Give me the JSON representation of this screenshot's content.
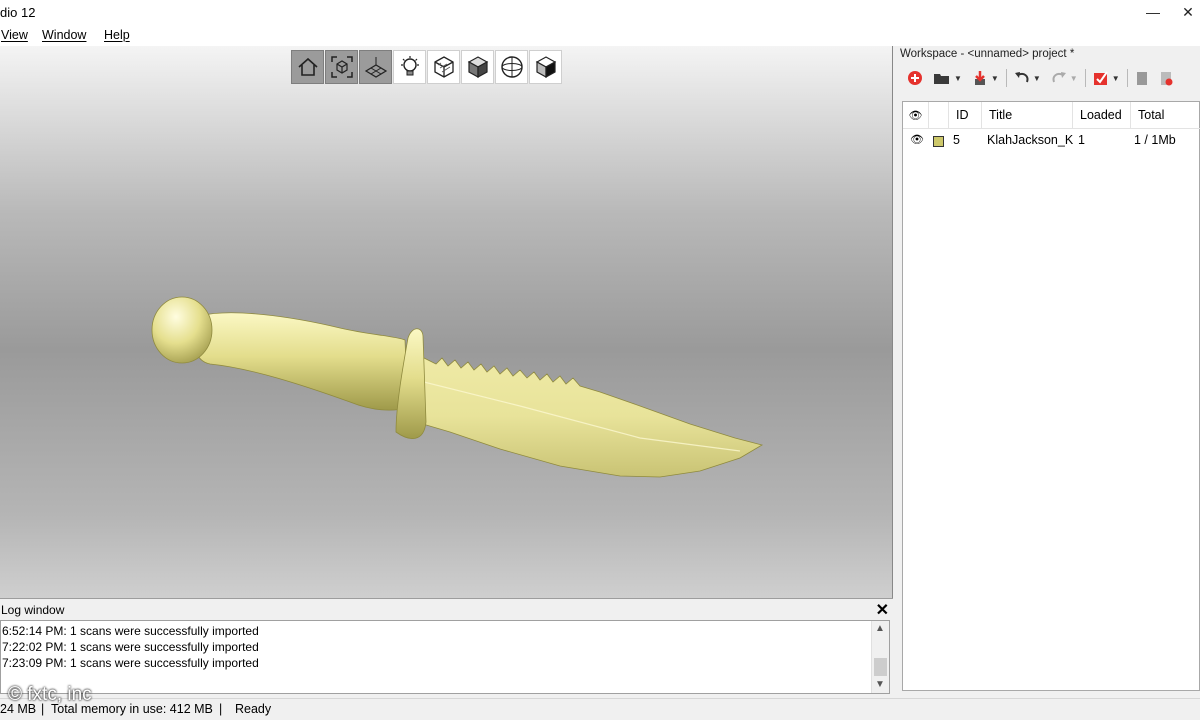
{
  "titlebar": {
    "title": "dio 12",
    "minimize": "—",
    "close": "✕"
  },
  "menu": {
    "view": "View",
    "window": "Window",
    "help": "Help"
  },
  "viewport": {
    "tools": [
      "home-view-icon",
      "fit-view-icon",
      "grid-view-icon",
      "light-bulb-icon",
      "wireframe-cube-icon",
      "shaded-cube-icon",
      "sphere-icon",
      "textured-cube-icon"
    ],
    "object_color": "#e8e39a"
  },
  "log": {
    "title": "Log window",
    "close": "✕",
    "lines": [
      "6:52:14 PM: 1 scans were successfully imported",
      "7:22:02 PM: 1 scans were successfully imported",
      "7:23:09 PM: 1 scans were successfully imported"
    ],
    "scroll_up": "▲",
    "scroll_down": "▼"
  },
  "status": {
    "mem_current": "24 MB",
    "sep1": "|",
    "total_memory": "Total memory in use: 412 MB",
    "sep2": "|",
    "state": "Ready",
    "watermark": "© fxtc, inc"
  },
  "workspace": {
    "title": "Workspace - <unnamed> project *",
    "toolbar": [
      "new-project-icon",
      "open-folder-icon",
      "import-icon",
      "undo-icon",
      "redo-icon",
      "check-icon",
      "copy-icon",
      "delete-icon"
    ],
    "columns": {
      "visible": "👁",
      "id": "ID",
      "title": "Title",
      "loaded": "Loaded",
      "total": "Total"
    },
    "rows": [
      {
        "visible": "👁",
        "id": "5",
        "title": "KlahJackson_Kr",
        "loaded": "1",
        "total": "1 / 1Mb",
        "color": "#cdc86a"
      }
    ]
  }
}
